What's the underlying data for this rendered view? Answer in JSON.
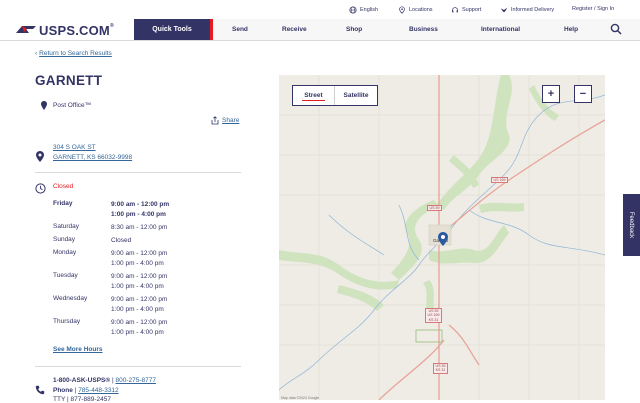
{
  "utility": {
    "english": "English",
    "locations": "Locations",
    "support": "Support",
    "informed_delivery": "Informed Delivery",
    "register": "Register / Sign In"
  },
  "logo": {
    "text": "USPS.COM",
    "mark": "®"
  },
  "nav": {
    "quick_tools": "Quick Tools",
    "send": "Send",
    "receive": "Receive",
    "shop": "Shop",
    "business": "Business",
    "international": "International",
    "help": "Help"
  },
  "back_link": "Return to Search Results",
  "office": {
    "name": "GARNETT",
    "type": "Post Office™",
    "share": "Share",
    "address_line1": "304 S OAK ST",
    "address_line2": "GARNETT, KS 66032-9998",
    "status": "Closed"
  },
  "hours": [
    {
      "day": "Friday",
      "times": [
        "9:00 am - 12:00 pm",
        "1:00 pm - 4:00 pm"
      ],
      "bold": true
    },
    {
      "day": "Saturday",
      "times": [
        "8:30 am - 12:00 pm"
      ],
      "bold": false
    },
    {
      "day": "Sunday",
      "times": [
        "Closed"
      ],
      "bold": false
    },
    {
      "day": "Monday",
      "times": [
        "9:00 am - 12:00 pm",
        "1:00 pm - 4:00 pm"
      ],
      "bold": false
    },
    {
      "day": "Tuesday",
      "times": [
        "9:00 am - 12:00 pm",
        "1:00 pm - 4:00 pm"
      ],
      "bold": false
    },
    {
      "day": "Wednesday",
      "times": [
        "9:00 am - 12:00 pm",
        "1:00 pm - 4:00 pm"
      ],
      "bold": false
    },
    {
      "day": "Thursday",
      "times": [
        "9:00 am - 12:00 pm",
        "1:00 pm - 4:00 pm"
      ],
      "bold": false
    }
  ],
  "see_more_hours": "See More Hours",
  "contact": {
    "toll_free": "1-800-ASK-USPS®",
    "separator": " | ",
    "alt_number": "800-275-8777",
    "phone_label": "Phone",
    "phone": "785-448-3312",
    "tty": "TTY | 877-889-2457"
  },
  "map": {
    "street": "Street",
    "satellite": "Satellite",
    "zoom_in": "+",
    "zoom_out": "−",
    "roads": {
      "us169_north": "US 169",
      "us59_north": "US 59",
      "us59_south": [
        "US 59",
        "US 169",
        "KS 31"
      ],
      "us59_far_south": [
        "US 59",
        "KS 31"
      ]
    },
    "town": "Garnett",
    "footer": "Map data ©2024 Google"
  },
  "feedback": "Feedback",
  "colors": {
    "navy": "#333366",
    "red": "#e71921",
    "link": "#336699"
  }
}
